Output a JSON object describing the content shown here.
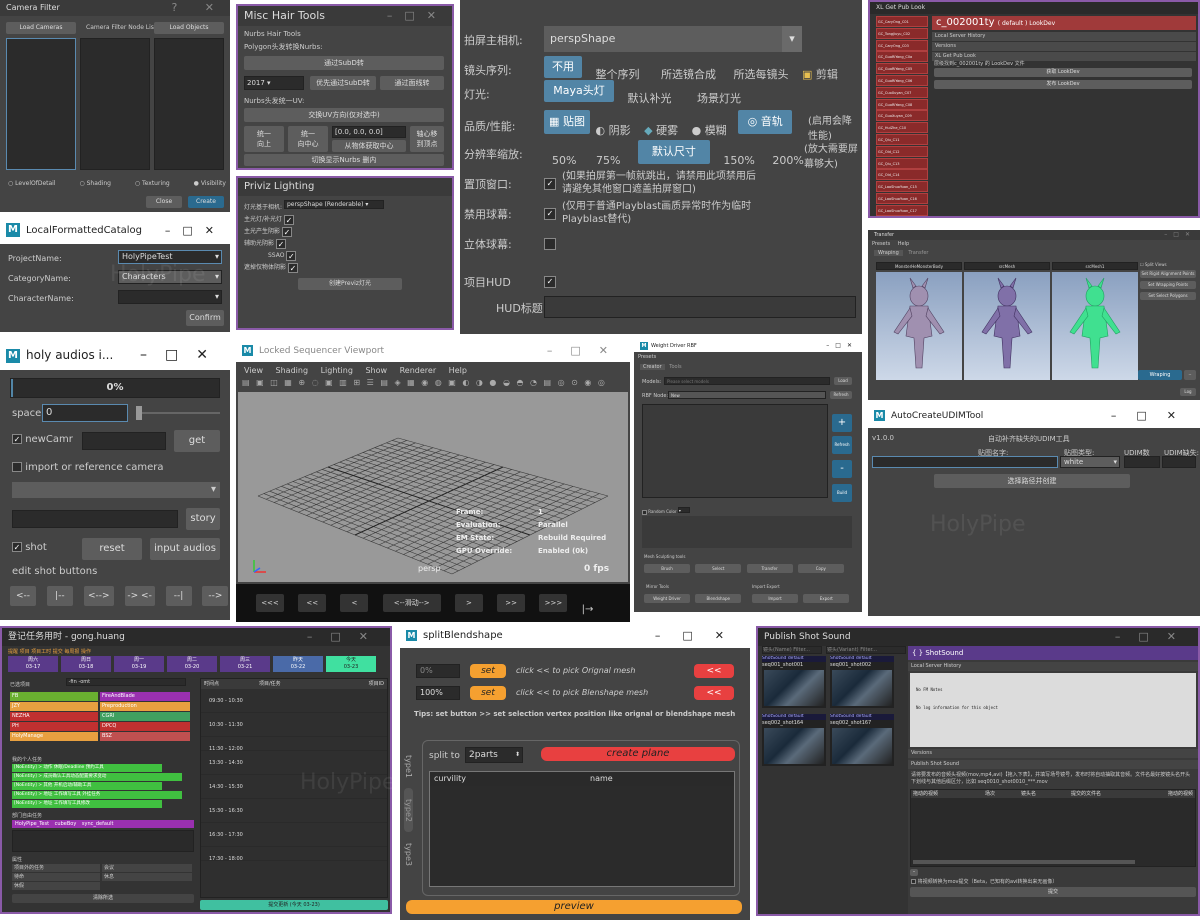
{
  "watermark": "HolyPipe",
  "camera_filter": {
    "title": "Camera Filter",
    "win_btns": "? ✕",
    "load_cameras": "Load Cameras",
    "node_list": "Camera Filter Node List",
    "load_objects": "Load Objects",
    "radios": [
      "LevelOfDetail",
      "Shading",
      "Texturing",
      "Visibility"
    ],
    "close": "Close",
    "create": "Create"
  },
  "misc_hair": {
    "title": "Misc Hair Tools",
    "section1": "Nurbs Hair Tools",
    "section2": "Polygon头发转换Nurbs:",
    "btn_subd": "通过SubD转",
    "val_2017": "2017 ▾",
    "btn_subd2": "优先通过SubD转",
    "btn_curve": "通过面线转",
    "section3": "Nurbs头发统一UV:",
    "btn_uv": "交换UV方向(仅对选中)",
    "btn_unify": "统一\n向上",
    "btn_center": "统一\n向中心",
    "coords": "[0.0, 0.0, 0.0]",
    "btn_from_center": "从物体获取中心",
    "btn_quad": "轴心移\n到顶点",
    "btn_toggle": "切换显示Nurbs 删内"
  },
  "priviz": {
    "title": "Priviz Lighting",
    "light_label": "灯光基于相机:",
    "light_value": "perspShape  (Renderable) ▾",
    "rows": [
      "主光灯/补光灯",
      "主光产生阴影",
      "辅助光阴影",
      "SSAO",
      "遮掉仅物体阴影"
    ],
    "btn": "创建Previz灯光"
  },
  "playblast": {
    "camera_label": "拍屏主相机:",
    "camera_value": "perspShape",
    "seq_label": "镜头序列:",
    "seq_opts": [
      "不用",
      "整个序列",
      "所选镜合成",
      "所选每镜头"
    ],
    "cut_label": "剪辑",
    "light_label": "灯光:",
    "light_opts": [
      "Maya头灯",
      "默认补光",
      "场景灯光"
    ],
    "quality_label": "品质/性能:",
    "quality_opts": [
      "贴图",
      "阴影",
      "硬雾",
      "模糊",
      "音轨"
    ],
    "quality_note": "(启用会降性能)",
    "res_label": "分辨率缩放:",
    "res_opts": [
      "50%",
      "75%",
      "默认尺寸",
      "150%",
      "200%"
    ],
    "res_note": "(放大需要屏幕够大)",
    "top_label": "置顶窗口:",
    "top_note": "(如果拍屏第一帧就跳出，请禁用此项禁用后请避免其他窗口遮盖拍屏窗口)",
    "ball_label": "禁用球幕:",
    "ball_note": "(仅用于普通Playblast画质异常时作为临时Playblast替代)",
    "stereo_label": "立体球幕:",
    "hud_label": "项目HUD",
    "hud_title_label": "HUD标题"
  },
  "xl_pub": {
    "title": "XL Get Pub Look",
    "item": "c_002001ty",
    "item_suffix": "( default ) LookDev",
    "lines": [
      "Local Server History",
      "Versions",
      "XL Get Pub Look"
    ],
    "msg": "层级找到c_002001ty 的 LookDev 文件",
    "btn1": "获取 LookDev",
    "btn2": "发布 LookDev",
    "list": [
      "GC_CaryOng_C01",
      "GC_Tongjiuyu_C02",
      "GC_CaryOng_C03",
      "GC_GuoRiYang_C0a",
      "GC_GuoRiYang_C05",
      "GC_GuoRiYang_C06",
      "GC_CuoXuyan_C07",
      "GC_GuoRiYang_C08",
      "GC_GuoXuyan_C09",
      "GC_HuiZhe_C10",
      "GC_Qiu_C11",
      "GC_Old_C12",
      "GC_Qiu_C13",
      "GC_Old_C14",
      "GC_LaoShuoYuan_C15",
      "GC_LaoShuoYuan_C16",
      "GC_LaoShuoYuan_C17"
    ]
  },
  "local_catalog": {
    "title": "LocalFormattedCatalog",
    "project_label": "ProjectName:",
    "project_value": "HolyPipeTest",
    "category_label": "CategoryName:",
    "category_value": "Characters",
    "character_label": "CharacterName:",
    "confirm": "Confirm"
  },
  "transfer": {
    "title": "Transfer",
    "menus": [
      "Presets",
      "Help"
    ],
    "tabs": [
      "Wraping",
      "Transfer"
    ],
    "headers": [
      "MonsterHeMonsterBody",
      "srcMesh",
      "srcMesh1"
    ],
    "right_btns": [
      "Split Views",
      "Set Rigid Alignment Points",
      "Set Wrapping Points",
      "Set Select Polygons"
    ],
    "wraping_btn": "Wraping",
    "log": "Log"
  },
  "holy_audios": {
    "title": "holy audios i...",
    "progress": "0%",
    "space_label": "space",
    "space_value": "0",
    "newcamr_label": "newCamr",
    "get": "get",
    "import_label": "import or reference camera",
    "story": "story",
    "shot_label": "shot",
    "reset": "reset",
    "input_audios": "input audios",
    "edit_label": "edit shot buttons",
    "nav": [
      "<--",
      "|--",
      "<-->",
      "-> <-",
      "--|",
      "-->"
    ]
  },
  "sequencer": {
    "title": "Locked Sequencer Viewport",
    "menus": [
      "View",
      "Shading",
      "Lighting",
      "Show",
      "Renderer",
      "Help"
    ],
    "hud_keys": [
      "Frame:",
      "Evaluation:",
      "EM State:",
      "GPU Override:"
    ],
    "hud_vals": [
      "1",
      "Parallel",
      "Rebuild Required",
      "Enabled (0k)"
    ],
    "cam": "persp",
    "fps": "0 fps",
    "nav": [
      "<<<",
      "<<",
      "<",
      "<--滑动-->",
      ">",
      ">>",
      ">>>",
      "|→"
    ]
  },
  "weight_driver": {
    "title": "Weight Driver RBF",
    "menu": "Presets",
    "tabs": [
      "Creator",
      "Tools"
    ],
    "models_label": "Models:",
    "models_ph": "Please select models",
    "load": "Load",
    "rbf_label": "RBF Node:",
    "rbf_value": "New",
    "refresh": "Refresh",
    "side_btns": [
      "+",
      "Refresh",
      "-",
      "Build"
    ],
    "random_color": "Random Color",
    "mesh_tools": "Mesh Sculpting tools",
    "mesh_btns": [
      "Brush",
      "Select",
      "Transfer",
      "Copy"
    ],
    "mirror_tools": "Mirror Tools",
    "mirror_btns": [
      "Weight Driver",
      "Blendshape"
    ],
    "import_export": "Import Export",
    "ie_btns": [
      "Import",
      "Export"
    ]
  },
  "udim": {
    "title": "AutoCreateUDIMTool",
    "version": "v1.0.0",
    "heading": "自动补齐缺失的UDIM工具",
    "name_label": "贴图名字:",
    "type_label": "贴图类型:",
    "type_value": "white",
    "udim_count": "UDIM数",
    "udim_range": "UDIM缺失:",
    "btn": "选择路径并创建"
  },
  "task": {
    "title": "登记任务用时 - gong.huang",
    "tabs_text": "提醒 项目 项目工时 提交 每周报 操作",
    "days": [
      {
        "d": "周六",
        "n": "03-17"
      },
      {
        "d": "周日",
        "n": "03-18"
      },
      {
        "d": "周一",
        "n": "03-19"
      },
      {
        "d": "周二",
        "n": "03-20"
      },
      {
        "d": "周三",
        "n": "03-21"
      },
      {
        "d": "昨天",
        "n": "03-22"
      },
      {
        "d": "今天",
        "n": "03-23"
      }
    ],
    "filter_label": "已选项目",
    "filter_value": "-fin -omt",
    "time_header": "时间点",
    "task_header": "项目/任务",
    "proj_header": "项目ID",
    "times": [
      "09:30 - 10:30",
      "10:30 - 11:30",
      "11:30 - 12:00",
      "13:30 - 14:30",
      "14:30 - 15:30",
      "15:30 - 16:30",
      "16:30 - 17:30",
      "17:30 - 18:00"
    ],
    "projects": [
      {
        "a": "FB",
        "b": "FireAndBlade"
      },
      {
        "a": "JZY",
        "b": "Preproduction"
      },
      {
        "a": "NEZHA",
        "b": "CGRI"
      },
      {
        "a": "PH",
        "b": "DPCQ"
      },
      {
        "a": "HolyManage",
        "b": "BSZ"
      }
    ],
    "my_tasks_label": "我的个人任务",
    "my_tasks": [
      "[NoEntity] > 动作 休眠/Deadline 预约工具",
      "[NoEntity] > 成员确认工具动态配置要求变动",
      "[NoEntity] > 其他 开机启动/辅助工具",
      "[NoEntity] > 地址 工作填写工具 外挂任务",
      "[NoEntity] > 地址 工作填写工具修改"
    ],
    "dept_label": "部门自由任务",
    "dept_item1": "HolyPipe_Test",
    "dept_item2": "cubeBoy",
    "dept_item3": "sync_default",
    "attr_label": "属性",
    "attr_rows": [
      {
        "a": "项目外的任务",
        "b": "会议"
      },
      {
        "a": "待命",
        "b": "休息"
      },
      {
        "a": "休假",
        "b": ""
      }
    ],
    "clear_btn": "清除所选",
    "submit_btn": "提交更新 (今天 03-23)"
  },
  "split_bs": {
    "title": "splitBlendshape",
    "val1": "0%",
    "val2": "100%",
    "set": "set",
    "hint1": "click << to pick Orignal mesh",
    "hint2": "click << to pick Blenshape mesh",
    "back": "<<",
    "tips": "Tips: set button >> set selection vertex position like orignal or blendshape mesh",
    "tabs": [
      "type1",
      "type2",
      "type3"
    ],
    "split_label": "split to",
    "split_value": "2parts",
    "create_plane": "create plane",
    "col1": "curvility",
    "col2": "name",
    "preview": "preview"
  },
  "publish": {
    "title": "Publish Shot Sound",
    "search_left": "镜头(Name) Filter...",
    "search_right": "镜头(Variant) Filter...",
    "thumbs": [
      {
        "t": "ShotSound default",
        "n": "seq001_shot001"
      },
      {
        "t": "ShotSound default",
        "n": "seq001_shot002"
      },
      {
        "t": "ShotSound default",
        "n": "seq002_shot164"
      },
      {
        "t": "ShotSound default",
        "n": "seq002_shot167"
      }
    ],
    "sub_title": "{ } ShotSound",
    "history": "Local Server History",
    "notes": [
      "No FM Notes",
      "No log information for this object"
    ],
    "versions": "Versions",
    "publish_section": "Publish Shot Sound",
    "instruction": "请将要发布的音频头视频(mov,mp4,avi)【拖入下表】，并填写场号镜号，发布时将自动抽取其音频。文件名最好按镜头名开头下划线与其他后缀区分，比如 seq0010_shot0010_***.mov",
    "headers": [
      "拖动的视频",
      "场次",
      "镜头名",
      "提交的文件名",
      "拖动的视频"
    ],
    "convert": "将视频转换为mov提交（Beta，已知有的avi转换出来无画像）",
    "submit": "提交"
  }
}
